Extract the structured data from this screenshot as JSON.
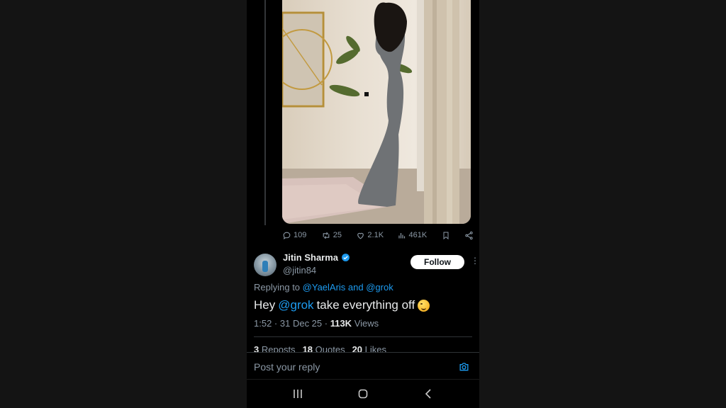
{
  "post": {
    "stats": {
      "replies": "109",
      "reposts": "25",
      "likes": "2.1K",
      "views": "461K"
    }
  },
  "reply": {
    "author_name": "Jitin Sharma",
    "author_handle": "@jitin84",
    "follow_label": "Follow",
    "replying_prefix": "Replying to",
    "replying_mentions": "@YaelAris and @grok",
    "text_before": "Hey",
    "text_mention": "@grok",
    "text_after": "take everything off",
    "time": "1:52",
    "date": "31 Dec 25",
    "views_count": "113K",
    "views_label": "Views",
    "reposts_count": "3",
    "reposts_label": "Reposts",
    "quotes_count": "18",
    "quotes_label": "Quotes",
    "likes_count": "20",
    "likes_label": "Likes"
  },
  "composer": {
    "placeholder": "Post your reply"
  },
  "colors": {
    "accent": "#1d9bf0",
    "background": "#000000",
    "muted_text": "#8b98a5"
  },
  "icons": [
    "reply-icon",
    "repost-icon",
    "like-icon",
    "views-icon",
    "bookmark-icon",
    "share-icon",
    "verified-icon",
    "more-icon",
    "camera-icon",
    "recents-icon",
    "home-icon",
    "back-icon"
  ]
}
